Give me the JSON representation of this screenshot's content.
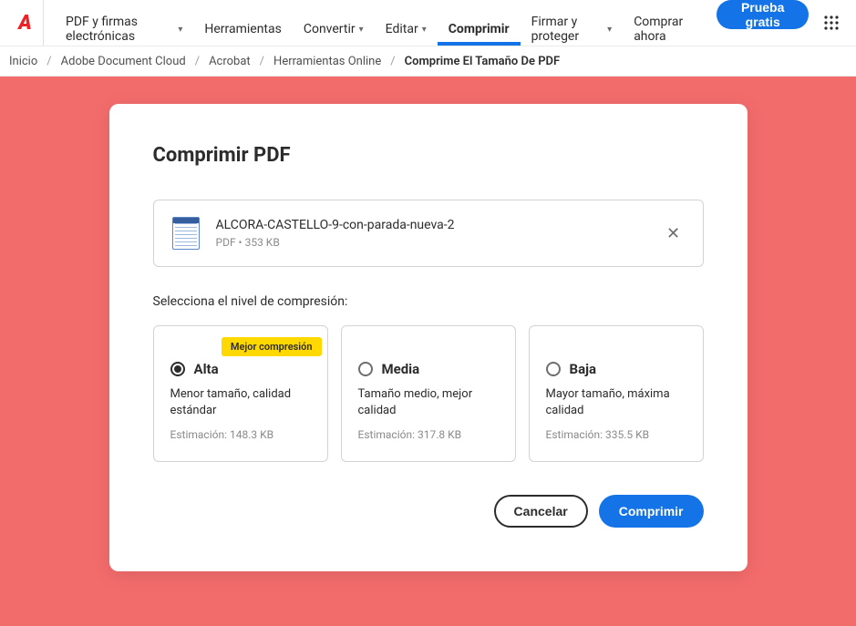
{
  "nav": {
    "pdf_signatures": "PDF y firmas electrónicas",
    "tools": "Herramientas",
    "convert": "Convertir",
    "edit": "Editar",
    "compress": "Comprimir",
    "sign_protect": "Firmar y proteger",
    "buy_now": "Comprar ahora",
    "free_trial": "Prueba gratis"
  },
  "breadcrumb": {
    "home": "Inicio",
    "adc": "Adobe Document Cloud",
    "acrobat": "Acrobat",
    "online_tools": "Herramientas Online",
    "current": "Comprime El Tamaño De PDF"
  },
  "card": {
    "title": "Comprimir PDF",
    "file": {
      "name": "ALCORA-CASTELLO-9-con-parada-nueva-2",
      "meta": "PDF • 353 KB"
    },
    "section_label": "Selecciona el nivel de compresión:",
    "options": [
      {
        "badge": "Mejor compresión",
        "title": "Alta",
        "desc": "Menor tamaño, calidad estándar",
        "estimate": "Estimación: 148.3 KB",
        "selected": true
      },
      {
        "badge": "",
        "title": "Media",
        "desc": "Tamaño medio, mejor calidad",
        "estimate": "Estimación: 317.8 KB",
        "selected": false
      },
      {
        "badge": "",
        "title": "Baja",
        "desc": "Mayor tamaño, máxima calidad",
        "estimate": "Estimación: 335.5 KB",
        "selected": false
      }
    ],
    "cancel": "Cancelar",
    "confirm": "Comprimir"
  }
}
